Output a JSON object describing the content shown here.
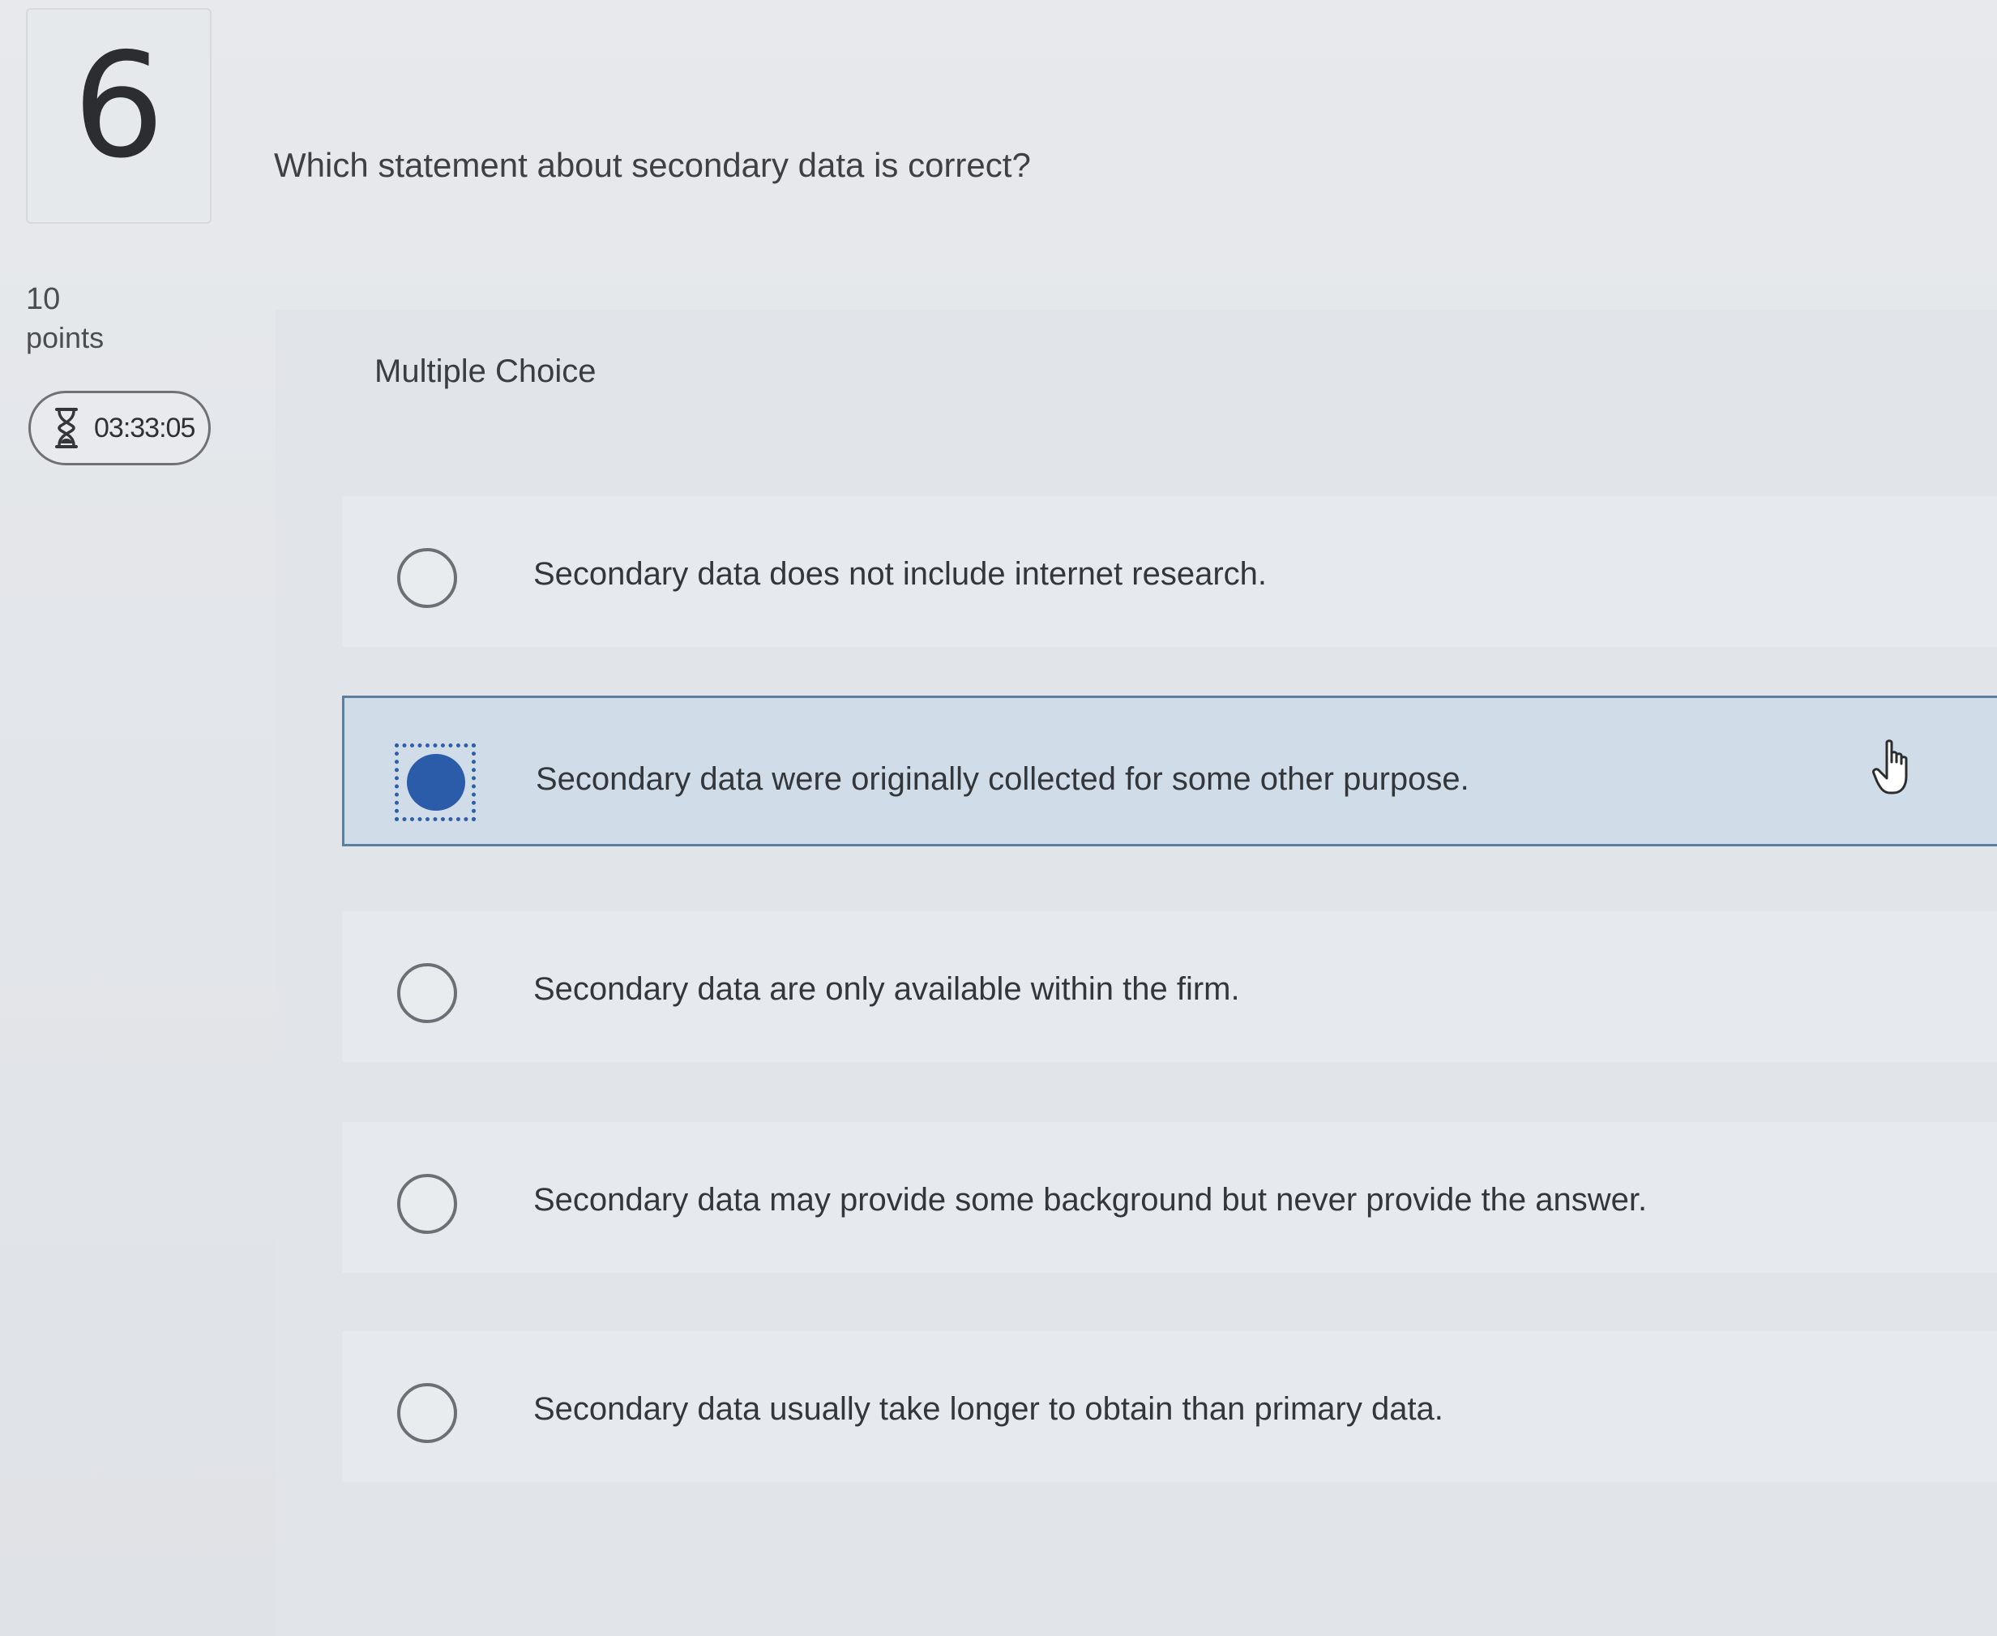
{
  "question": {
    "number": "6",
    "points_value": "10",
    "points_label": "points",
    "timer": "03:33:05",
    "prompt": "Which statement about secondary data is correct?",
    "type_label": "Multiple Choice"
  },
  "options": [
    {
      "text": "Secondary data does not include internet research.",
      "selected": false
    },
    {
      "text": "Secondary data were originally collected for some other purpose.",
      "selected": true
    },
    {
      "text": "Secondary data are only available within the firm.",
      "selected": false
    },
    {
      "text": "Secondary data may provide some background but never provide the answer.",
      "selected": false
    },
    {
      "text": "Secondary data usually take longer to obtain than primary data.",
      "selected": false
    }
  ],
  "icons": {
    "timer": "hourglass-icon",
    "pointer": "hand-pointer-icon"
  },
  "colors": {
    "selected_fill": "#2a5caa",
    "selected_bg": "#d0dde9",
    "selected_border": "#5d7f9f"
  }
}
